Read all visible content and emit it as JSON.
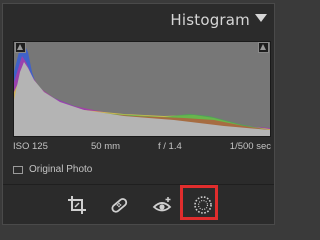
{
  "panel": {
    "title": "Histogram"
  },
  "info": {
    "iso": "ISO 125",
    "focal_length": "50 mm",
    "aperture": "f / 1.4",
    "shutter": "1/500 sec"
  },
  "original_photo": {
    "label": "Original Photo",
    "checked": false
  },
  "toolbar": {
    "tools": [
      "crop-overlay-icon",
      "spot-removal-icon",
      "red-eye-icon",
      "masking-icon"
    ],
    "highlighted_tool": "masking-icon",
    "highlight_color": "#e02d2d"
  },
  "colors": {
    "histogram_bg": "#777777",
    "panel_bg": "#2b2b2b",
    "text": "#c4c4c4"
  }
}
